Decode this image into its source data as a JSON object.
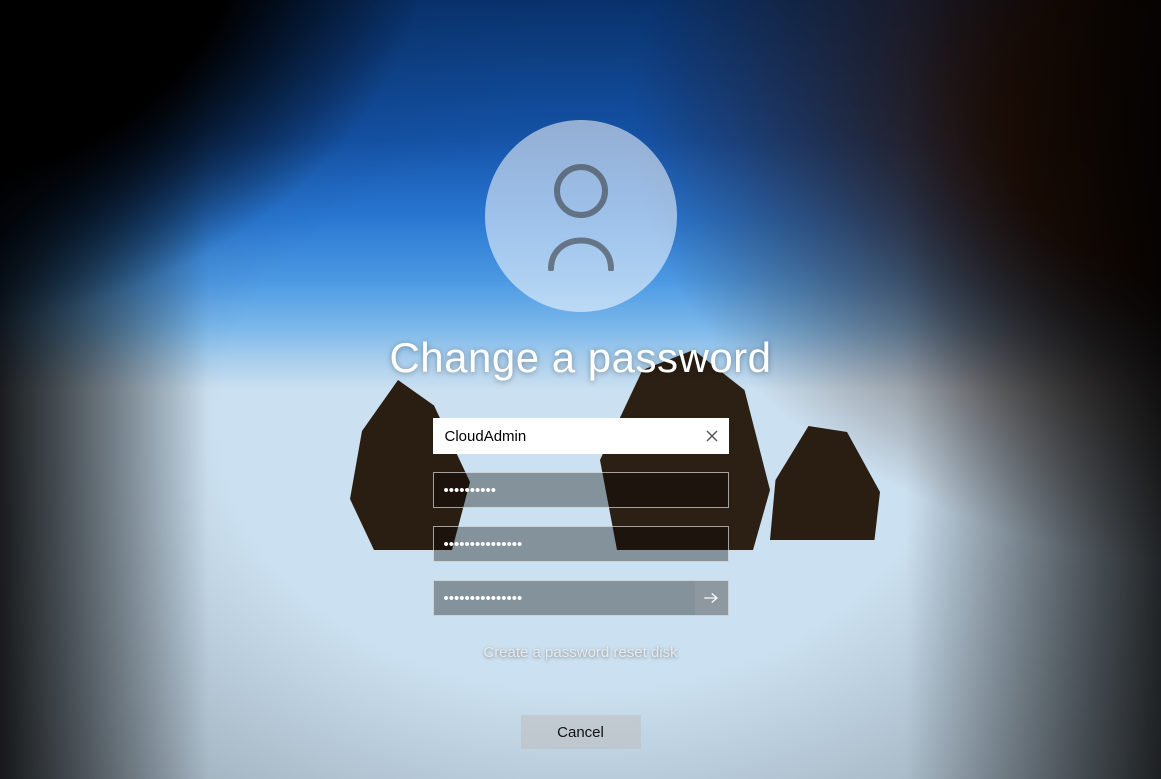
{
  "title": "Change a password",
  "username": {
    "value": "CloudAdmin"
  },
  "old_password": {
    "value": "••••••••••"
  },
  "new_password": {
    "value": "•••••••••••••••"
  },
  "confirm_password": {
    "value": "•••••••••••••••"
  },
  "reset_link": "Create a password reset disk",
  "cancel_label": "Cancel"
}
